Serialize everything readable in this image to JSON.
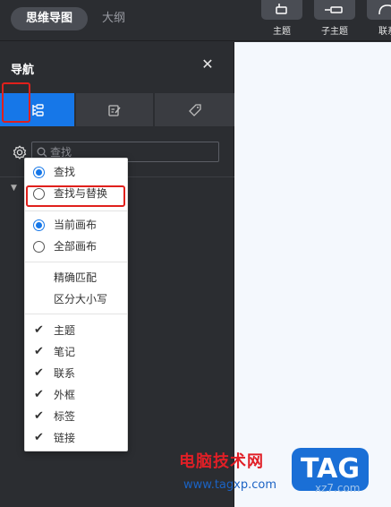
{
  "header": {
    "view_tabs": [
      {
        "label": "思维导图",
        "active": true
      },
      {
        "label": "大纲",
        "active": false
      }
    ],
    "tools": [
      {
        "label": "主题",
        "icon": "topic-icon"
      },
      {
        "label": "子主题",
        "icon": "subtopic-icon"
      },
      {
        "label": "联系",
        "icon": "connect-icon"
      }
    ]
  },
  "panel": {
    "title": "导航",
    "close_icon": "close-icon",
    "tabs": [
      {
        "icon": "outline-tree-icon",
        "active": true
      },
      {
        "icon": "note-edit-icon",
        "active": false
      },
      {
        "icon": "tag-icon",
        "active": false
      }
    ],
    "search": {
      "placeholder": "查找",
      "value": ""
    }
  },
  "menu": {
    "mode": [
      {
        "label": "查找",
        "selected": true
      },
      {
        "label": "查找与替换",
        "selected": false
      }
    ],
    "scope": [
      {
        "label": "当前画布",
        "selected": true
      },
      {
        "label": "全部画布",
        "selected": false
      }
    ],
    "options": [
      {
        "label": "精确匹配",
        "checked": false
      },
      {
        "label": "区分大小写",
        "checked": false
      }
    ],
    "filters": [
      {
        "label": "主题",
        "checked": true
      },
      {
        "label": "笔记",
        "checked": true
      },
      {
        "label": "联系",
        "checked": true
      },
      {
        "label": "外框",
        "checked": true
      },
      {
        "label": "标签",
        "checked": true
      },
      {
        "label": "链接",
        "checked": true
      }
    ]
  },
  "watermark": {
    "site_name": "电脑技术网",
    "url": "www.tagxp.com",
    "badge": "TAG",
    "faint": "xz7.com"
  },
  "colors": {
    "accent": "#1677e8",
    "highlight": "#e0201c",
    "panel_bg": "#2b2d31",
    "canvas_bg": "#f4f8fd"
  }
}
